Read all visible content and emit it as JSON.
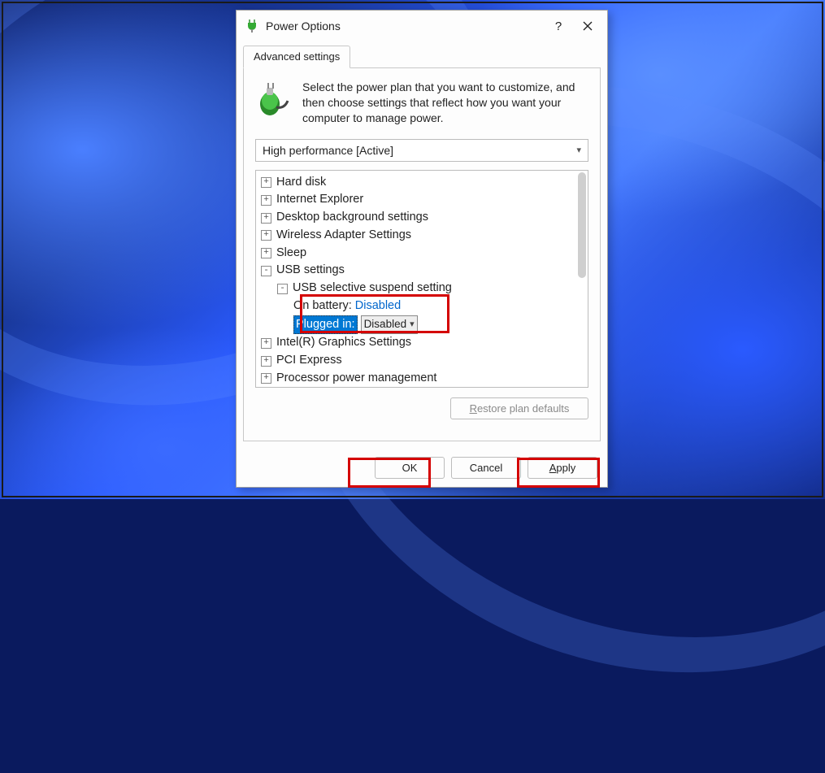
{
  "window": {
    "title": "Power Options",
    "help_hint": "?",
    "close_hint": "Close"
  },
  "tab": {
    "label": "Advanced settings"
  },
  "intro": "Select the power plan that you want to customize, and then choose settings that reflect how you want your computer to manage power.",
  "plan_selected": "High performance [Active]",
  "tree": {
    "hard_disk": "Hard disk",
    "ie": "Internet Explorer",
    "desktop_bg": "Desktop background settings",
    "wireless": "Wireless Adapter Settings",
    "sleep": "Sleep",
    "usb": "USB settings",
    "usb_suspend": "USB selective suspend setting",
    "on_battery_label": "On battery:",
    "on_battery_value": "Disabled",
    "plugged_in_label": "Plugged in:",
    "plugged_in_value": "Disabled",
    "intel_gfx": "Intel(R) Graphics Settings",
    "pci": "PCI Express",
    "ppm": "Processor power management"
  },
  "buttons": {
    "restore": "Restore plan defaults",
    "ok": "OK",
    "cancel": "Cancel",
    "apply": "Apply"
  },
  "colors": {
    "accent_red": "#d40000",
    "link_blue": "#0066cc",
    "selection": "#0078d4"
  }
}
